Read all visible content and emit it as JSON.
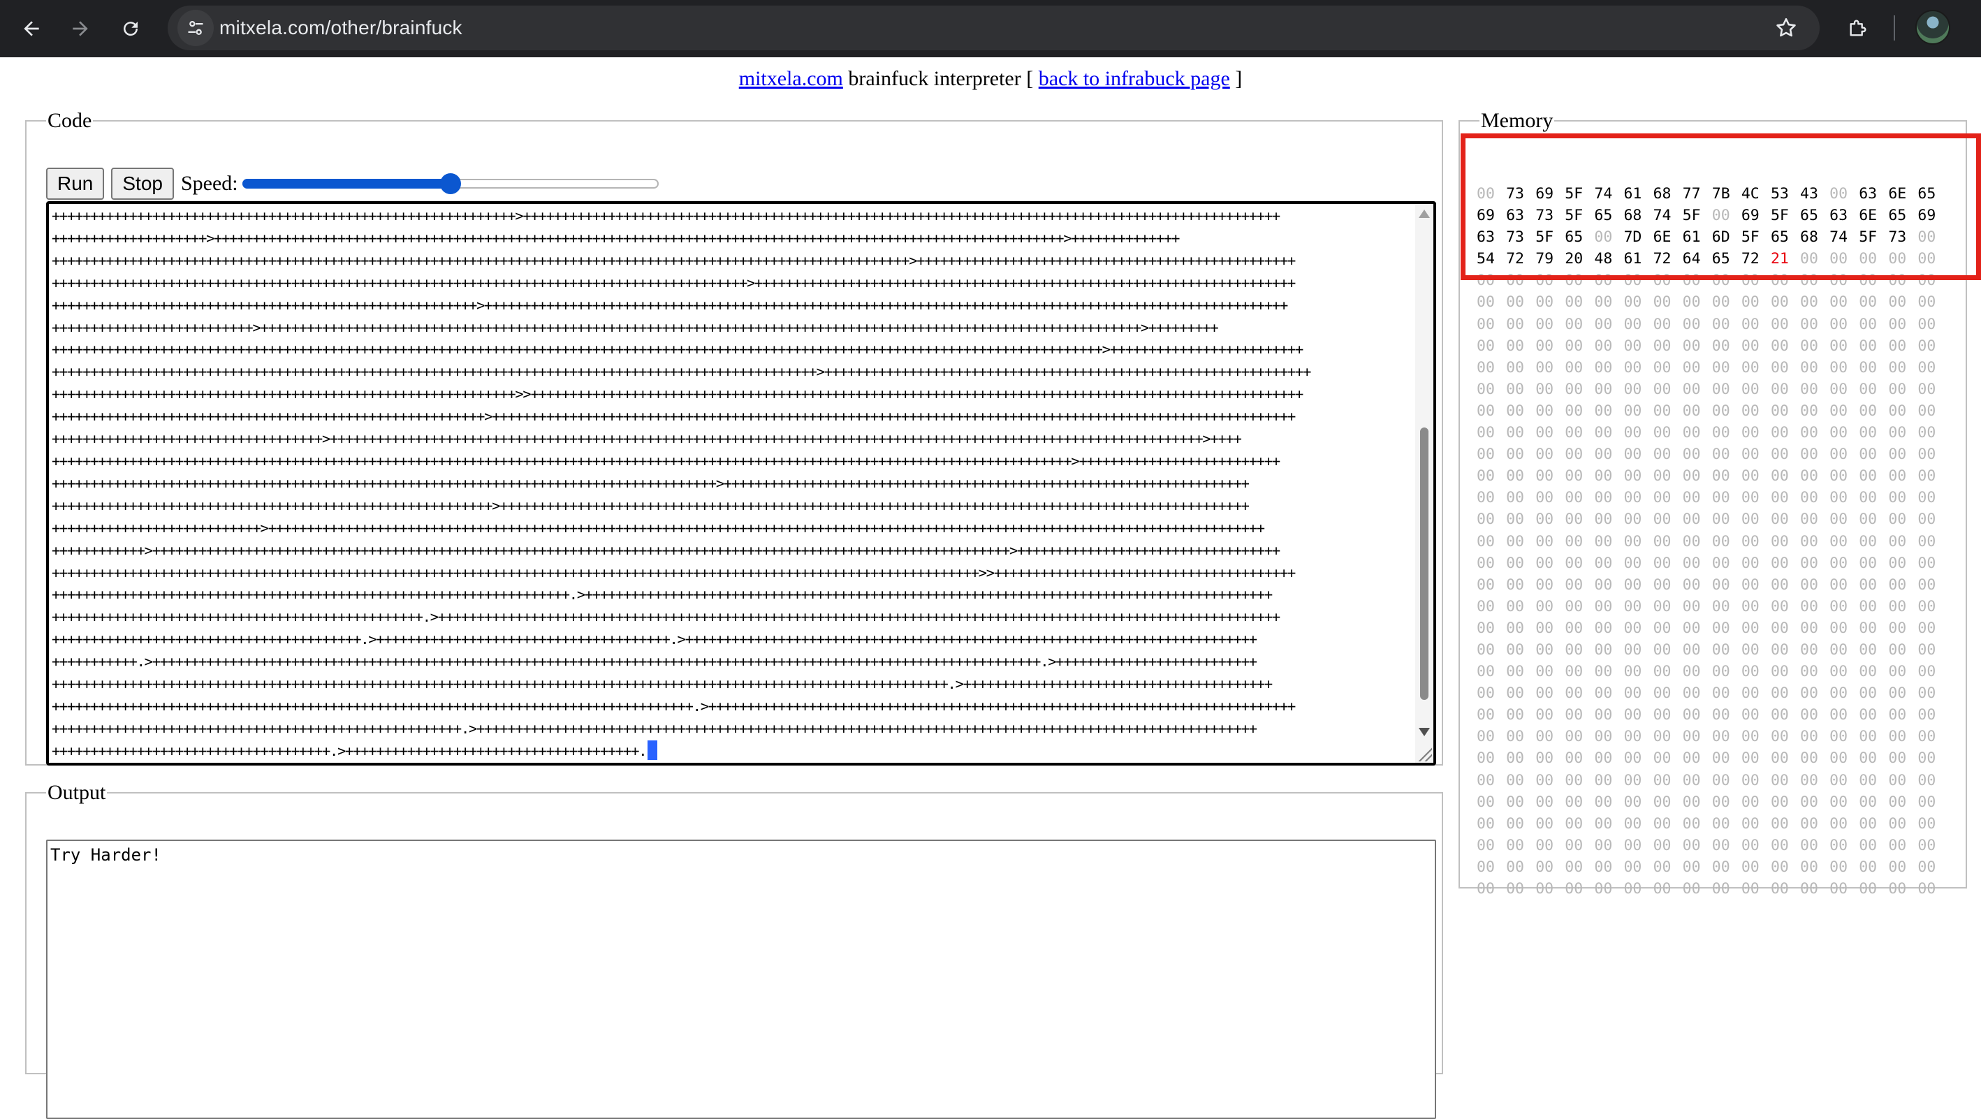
{
  "browser": {
    "url": "mitxela.com/other/brainfuck",
    "back_icon": "arrow-left-icon",
    "forward_icon": "arrow-right-icon",
    "reload_icon": "reload-icon"
  },
  "header": {
    "site_link": "mitxela.com",
    "title_text": " brainfuck interpreter [ ",
    "back_link": "back to infrabuck page",
    "close_bracket": " ]"
  },
  "code_panel": {
    "legend": "Code",
    "run_label": "Run",
    "stop_label": "Stop",
    "speed_label": "Speed:",
    "speed_value": 0.5,
    "lines": [
      "++++++++++++++++++++++++++++++++++++++++++++++++++++++++++++>++++++++++++++++++++++++++++++++++++++++++++++++++++++++++++++++++++++++++++++++++++++++++++++++++",
      "++++++++++++++++++++>++++++++++++++++++++++++++++++++++++++++++++++++++++++++++++++++++++++++++++++++++++++++++++++++++++++++++++++>++++++++++++++",
      "+++++++++++++++++++++++++++++++++++++++++++++++++++++++++++++++++++++++++++++++++++++++++++++++++++++++++++++++>+++++++++++++++++++++++++++++++++++++++++++++++++",
      "++++++++++++++++++++++++++++++++++++++++++++++++++++++++++++++++++++++++++++++++++++++++++>++++++++++++++++++++++++++++++++++++++++++++++++++++++++++++++++++++++",
      "+++++++++++++++++++++++++++++++++++++++++++++++++++++++>++++++++++++++++++++++++++++++++++++++++++++++++++++++++++++++++++++++++++++++++++++++++++++++++++++++++",
      "++++++++++++++++++++++++++>++++++++++++++++++++++++++++++++++++++++++++++++++++++++++++++++++++++++++++++++++++++++++++++++++++++++++++++++++>+++++++++",
      "++++++++++++++++++++++++++++++++++++++++++++++++++++++++++++++++++++++++++++++++++++++++++++++++++++++++++++++++++++++++++++++++++++++++>+++++++++++++++++++++++++",
      "+++++++++++++++++++++++++++++++++++++++++++++++++++++++++++++++++++++++++++++++++++++++++++++++++++>+++++++++++++++++++++++++++++++++++++++++++++++++++++++++++++++",
      "++++++++++++++++++++++++++++++++++++++++++++++++++++++++++++>>++++++++++++++++++++++++++++++++++++++++++++++++++++++++++++++++++++++++++++++++++++++++++++++++++++",
      "++++++++++++++++++++++++++++++++++++++++++++++++++++++++>++++++++++++++++++++++++++++++++++++++++++++++++++++++++++++++++++++++++++++++++++++++++++++++++++++++++",
      "+++++++++++++++++++++++++++++++++++>+++++++++++++++++++++++++++++++++++++++++++++++++++++++++++++++++++++++++++++++++++++++++++++++++++++++++++++++++>++++",
      "++++++++++++++++++++++++++++++++++++++++++++++++++++++++++++++++++++++++++++++++++++++++++++++++++++++++++++++++++++++++++++++++++++>++++++++++++++++++++++++++",
      "++++++++++++++++++++++++++++++++++++++++++++++++++++++++++++++++++++++++++++++++++++++>++++++++++++++++++++++++++++++++++++++++++++++++++++++++++++++++++++",
      "+++++++++++++++++++++++++++++++++++++++++++++++++++++++++>+++++++++++++++++++++++++++++++++++++++++++++++++++++++++++++++++++++++++++++++++++++++++++++++++",
      "+++++++++++++++++++++++++++>+++++++++++++++++++++++++++++++++++++++++++++++++++++++++++++++++++++++++++++++++++++++++++++++++++++++++++++++++++++++++++++++++",
      "++++++++++++>+++++++++++++++++++++++++++++++++++++++++++++++++++++++++++++++++++++++++++++++++++++++++++++++++++++++++++++++>++++++++++++++++++++++++++++++++++",
      "++++++++++++++++++++++++++++++++++++++++++++++++++++++++++++++++++++++++++++++++++++++++++++++++++++++++++++++++++++++++>>+++++++++++++++++++++++++++++++++++++++",
      "+++++++++++++++++++++++++++++++++++++++++++++++++++++++++++++++++++.>+++++++++++++++++++++++++++++++++++++++++++++++++++++++++++++++++++++++++++++++++++++++++",
      "++++++++++++++++++++++++++++++++++++++++++++++++.>+++++++++++++++++++++++++++++++++++++++++++++++++++++++++++++++++++++++++++++++++++++++++++++++++++++++++++++",
      "++++++++++++++++++++++++++++++++++++++++.>++++++++++++++++++++++++++++++++++++++.>++++++++++++++++++++++++++++++++++++++++++++++++++++++++++++++++++++++++++",
      "+++++++++++.>+++++++++++++++++++++++++++++++++++++++++++++++++++++++++++++++++++++++++++++++++++++++++++++++++++++++++++++++++++.>++++++++++++++++++++++++++",
      "++++++++++++++++++++++++++++++++++++++++++++++++++++++++++++++++++++++++++++++++++++++++++++++++++++++++++++++++++++.>++++++++++++++++++++++++++++++++++++++++",
      "+++++++++++++++++++++++++++++++++++++++++++++++++++++++++++++++++++++++++++++++++++.>++++++++++++++++++++++++++++++++++++++++++++++++++++++++++++++++++++++++++++",
      "+++++++++++++++++++++++++++++++++++++++++++++++++++++.>+++++++++++++++++++++++++++++++++++++++++++++++++++++++++++++++++++++++++++++++++++++++++++++++++++++",
      "++++++++++++++++++++++++++++++++++++.>++++++++++++++++++++++++++++++++++++++."
    ]
  },
  "output_panel": {
    "legend": "Output",
    "text": "Try Harder!"
  },
  "memory_panel": {
    "legend": "Memory",
    "rows": [
      [
        "00",
        "73",
        "69",
        "5F",
        "74",
        "61",
        "68",
        "77",
        "7B",
        "4C",
        "53",
        "43",
        "00",
        "63",
        "6E",
        "65"
      ],
      [
        "69",
        "63",
        "73",
        "5F",
        "65",
        "68",
        "74",
        "5F",
        "00",
        "69",
        "5F",
        "65",
        "63",
        "6E",
        "65",
        "69"
      ],
      [
        "63",
        "73",
        "5F",
        "65",
        "00",
        "7D",
        "6E",
        "61",
        "6D",
        "5F",
        "65",
        "68",
        "74",
        "5F",
        "73",
        "00"
      ],
      [
        "54",
        "72",
        "79",
        "20",
        "48",
        "61",
        "72",
        "64",
        "65",
        "72",
        "21",
        "00",
        "00",
        "00",
        "00",
        "00"
      ],
      [
        "00",
        "00",
        "00",
        "00",
        "00",
        "00",
        "00",
        "00",
        "00",
        "00",
        "00",
        "00",
        "00",
        "00",
        "00",
        "00"
      ],
      [
        "00",
        "00",
        "00",
        "00",
        "00",
        "00",
        "00",
        "00",
        "00",
        "00",
        "00",
        "00",
        "00",
        "00",
        "00",
        "00"
      ],
      [
        "00",
        "00",
        "00",
        "00",
        "00",
        "00",
        "00",
        "00",
        "00",
        "00",
        "00",
        "00",
        "00",
        "00",
        "00",
        "00"
      ],
      [
        "00",
        "00",
        "00",
        "00",
        "00",
        "00",
        "00",
        "00",
        "00",
        "00",
        "00",
        "00",
        "00",
        "00",
        "00",
        "00"
      ],
      [
        "00",
        "00",
        "00",
        "00",
        "00",
        "00",
        "00",
        "00",
        "00",
        "00",
        "00",
        "00",
        "00",
        "00",
        "00",
        "00"
      ],
      [
        "00",
        "00",
        "00",
        "00",
        "00",
        "00",
        "00",
        "00",
        "00",
        "00",
        "00",
        "00",
        "00",
        "00",
        "00",
        "00"
      ],
      [
        "00",
        "00",
        "00",
        "00",
        "00",
        "00",
        "00",
        "00",
        "00",
        "00",
        "00",
        "00",
        "00",
        "00",
        "00",
        "00"
      ],
      [
        "00",
        "00",
        "00",
        "00",
        "00",
        "00",
        "00",
        "00",
        "00",
        "00",
        "00",
        "00",
        "00",
        "00",
        "00",
        "00"
      ],
      [
        "00",
        "00",
        "00",
        "00",
        "00",
        "00",
        "00",
        "00",
        "00",
        "00",
        "00",
        "00",
        "00",
        "00",
        "00",
        "00"
      ],
      [
        "00",
        "00",
        "00",
        "00",
        "00",
        "00",
        "00",
        "00",
        "00",
        "00",
        "00",
        "00",
        "00",
        "00",
        "00",
        "00"
      ],
      [
        "00",
        "00",
        "00",
        "00",
        "00",
        "00",
        "00",
        "00",
        "00",
        "00",
        "00",
        "00",
        "00",
        "00",
        "00",
        "00"
      ],
      [
        "00",
        "00",
        "00",
        "00",
        "00",
        "00",
        "00",
        "00",
        "00",
        "00",
        "00",
        "00",
        "00",
        "00",
        "00",
        "00"
      ],
      [
        "00",
        "00",
        "00",
        "00",
        "00",
        "00",
        "00",
        "00",
        "00",
        "00",
        "00",
        "00",
        "00",
        "00",
        "00",
        "00"
      ],
      [
        "00",
        "00",
        "00",
        "00",
        "00",
        "00",
        "00",
        "00",
        "00",
        "00",
        "00",
        "00",
        "00",
        "00",
        "00",
        "00"
      ],
      [
        "00",
        "00",
        "00",
        "00",
        "00",
        "00",
        "00",
        "00",
        "00",
        "00",
        "00",
        "00",
        "00",
        "00",
        "00",
        "00"
      ],
      [
        "00",
        "00",
        "00",
        "00",
        "00",
        "00",
        "00",
        "00",
        "00",
        "00",
        "00",
        "00",
        "00",
        "00",
        "00",
        "00"
      ],
      [
        "00",
        "00",
        "00",
        "00",
        "00",
        "00",
        "00",
        "00",
        "00",
        "00",
        "00",
        "00",
        "00",
        "00",
        "00",
        "00"
      ],
      [
        "00",
        "00",
        "00",
        "00",
        "00",
        "00",
        "00",
        "00",
        "00",
        "00",
        "00",
        "00",
        "00",
        "00",
        "00",
        "00"
      ],
      [
        "00",
        "00",
        "00",
        "00",
        "00",
        "00",
        "00",
        "00",
        "00",
        "00",
        "00",
        "00",
        "00",
        "00",
        "00",
        "00"
      ],
      [
        "00",
        "00",
        "00",
        "00",
        "00",
        "00",
        "00",
        "00",
        "00",
        "00",
        "00",
        "00",
        "00",
        "00",
        "00",
        "00"
      ],
      [
        "00",
        "00",
        "00",
        "00",
        "00",
        "00",
        "00",
        "00",
        "00",
        "00",
        "00",
        "00",
        "00",
        "00",
        "00",
        "00"
      ],
      [
        "00",
        "00",
        "00",
        "00",
        "00",
        "00",
        "00",
        "00",
        "00",
        "00",
        "00",
        "00",
        "00",
        "00",
        "00",
        "00"
      ],
      [
        "00",
        "00",
        "00",
        "00",
        "00",
        "00",
        "00",
        "00",
        "00",
        "00",
        "00",
        "00",
        "00",
        "00",
        "00",
        "00"
      ],
      [
        "00",
        "00",
        "00",
        "00",
        "00",
        "00",
        "00",
        "00",
        "00",
        "00",
        "00",
        "00",
        "00",
        "00",
        "00",
        "00"
      ],
      [
        "00",
        "00",
        "00",
        "00",
        "00",
        "00",
        "00",
        "00",
        "00",
        "00",
        "00",
        "00",
        "00",
        "00",
        "00",
        "00"
      ],
      [
        "00",
        "00",
        "00",
        "00",
        "00",
        "00",
        "00",
        "00",
        "00",
        "00",
        "00",
        "00",
        "00",
        "00",
        "00",
        "00"
      ],
      [
        "00",
        "00",
        "00",
        "00",
        "00",
        "00",
        "00",
        "00",
        "00",
        "00",
        "00",
        "00",
        "00",
        "00",
        "00",
        "00"
      ],
      [
        "00",
        "00",
        "00",
        "00",
        "00",
        "00",
        "00",
        "00",
        "00",
        "00",
        "00",
        "00",
        "00",
        "00",
        "00",
        "00"
      ],
      [
        "00",
        "00",
        "00",
        "00",
        "00",
        "00",
        "00",
        "00",
        "00",
        "00",
        "00",
        "00",
        "00",
        "00",
        "00",
        "00"
      ]
    ],
    "pointer_row": 3,
    "pointer_col": 10,
    "pointer_color": "#e8000e",
    "zero_color": "#b8b8b8",
    "highlight_color": "#e32219"
  }
}
